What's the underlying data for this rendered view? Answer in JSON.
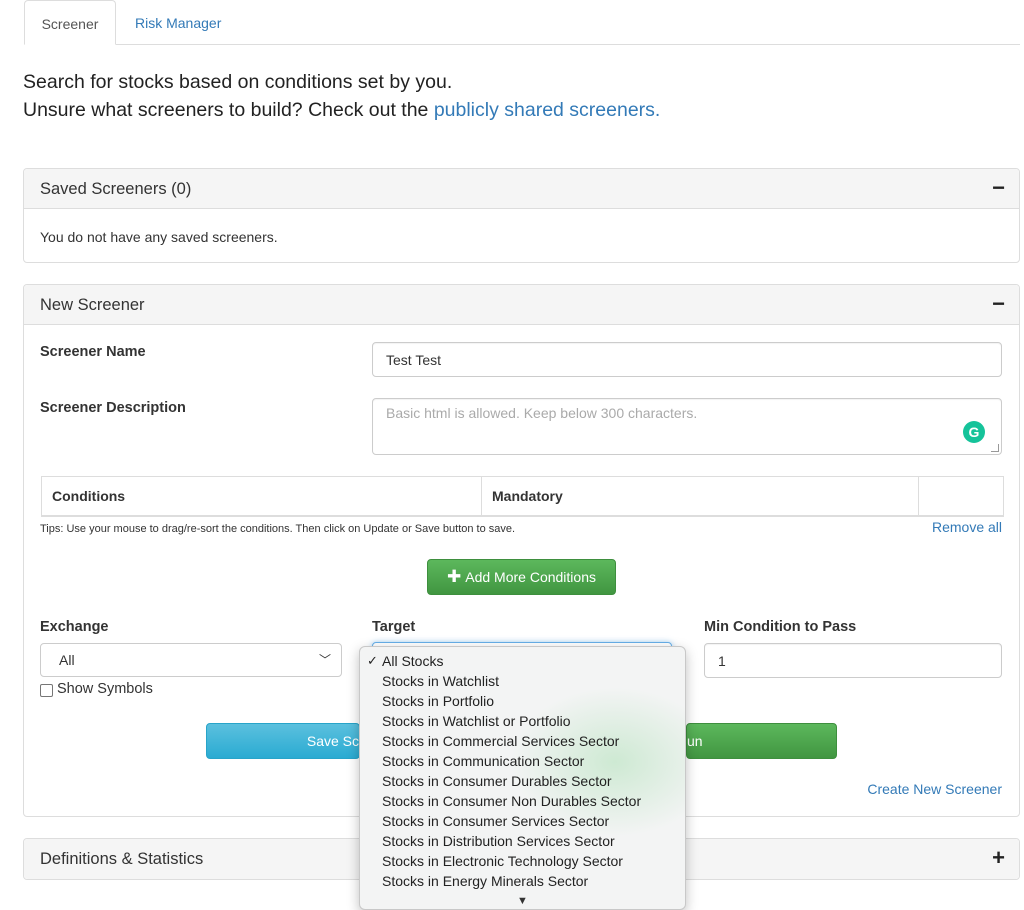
{
  "tabs": {
    "screener": "Screener",
    "risk_manager": "Risk Manager"
  },
  "intro": {
    "line1": "Search for stocks based on conditions set by you.",
    "line2_prefix": "Unsure what screeners to build? Check out the",
    "link": "publicly shared screeners."
  },
  "saved": {
    "title": "Saved Screeners (0)",
    "toggle": "−",
    "empty_text": "You do not have any saved screeners."
  },
  "new_screener": {
    "title": "New Screener",
    "toggle": "−",
    "name_label": "Screener Name",
    "name_value": "Test Test",
    "desc_label": "Screener Description",
    "desc_placeholder": "Basic html is allowed. Keep below 300 characters.",
    "conditions_header": "Conditions",
    "mandatory_header": "Mandatory",
    "tips": "Tips: Use your mouse to drag/re-sort the conditions. Then click on Update or Save button to save.",
    "remove_all": "Remove all",
    "add_conditions": "Add More Conditions",
    "exchange_label": "Exchange",
    "exchange_value": "All",
    "target_label": "Target",
    "min_label": "Min Condition to Pass",
    "min_value": "1",
    "show_symbols": "Show Symbols",
    "save_button_visible": "Save Sc",
    "run_button_visible": "un",
    "create_new": "Create New Screener"
  },
  "definitions": {
    "title": "Definitions & Statistics",
    "toggle": "+"
  },
  "target_dropdown": {
    "selected_index": 0,
    "options": [
      "All Stocks",
      "Stocks in Watchlist",
      "Stocks in Portfolio",
      "Stocks in Watchlist or Portfolio",
      "Stocks in Commercial Services Sector",
      "Stocks in Communication Sector",
      "Stocks in Consumer Durables Sector",
      "Stocks in Consumer Non Durables Sector",
      "Stocks in Consumer Services Sector",
      "Stocks in Distribution Services Sector",
      "Stocks in Electronic Technology Sector",
      "Stocks in Energy Minerals Sector"
    ]
  },
  "colors": {
    "link": "#337ab7",
    "success": "#5cb85c",
    "info": "#5bc0de",
    "grammarly": "#15c39a"
  }
}
